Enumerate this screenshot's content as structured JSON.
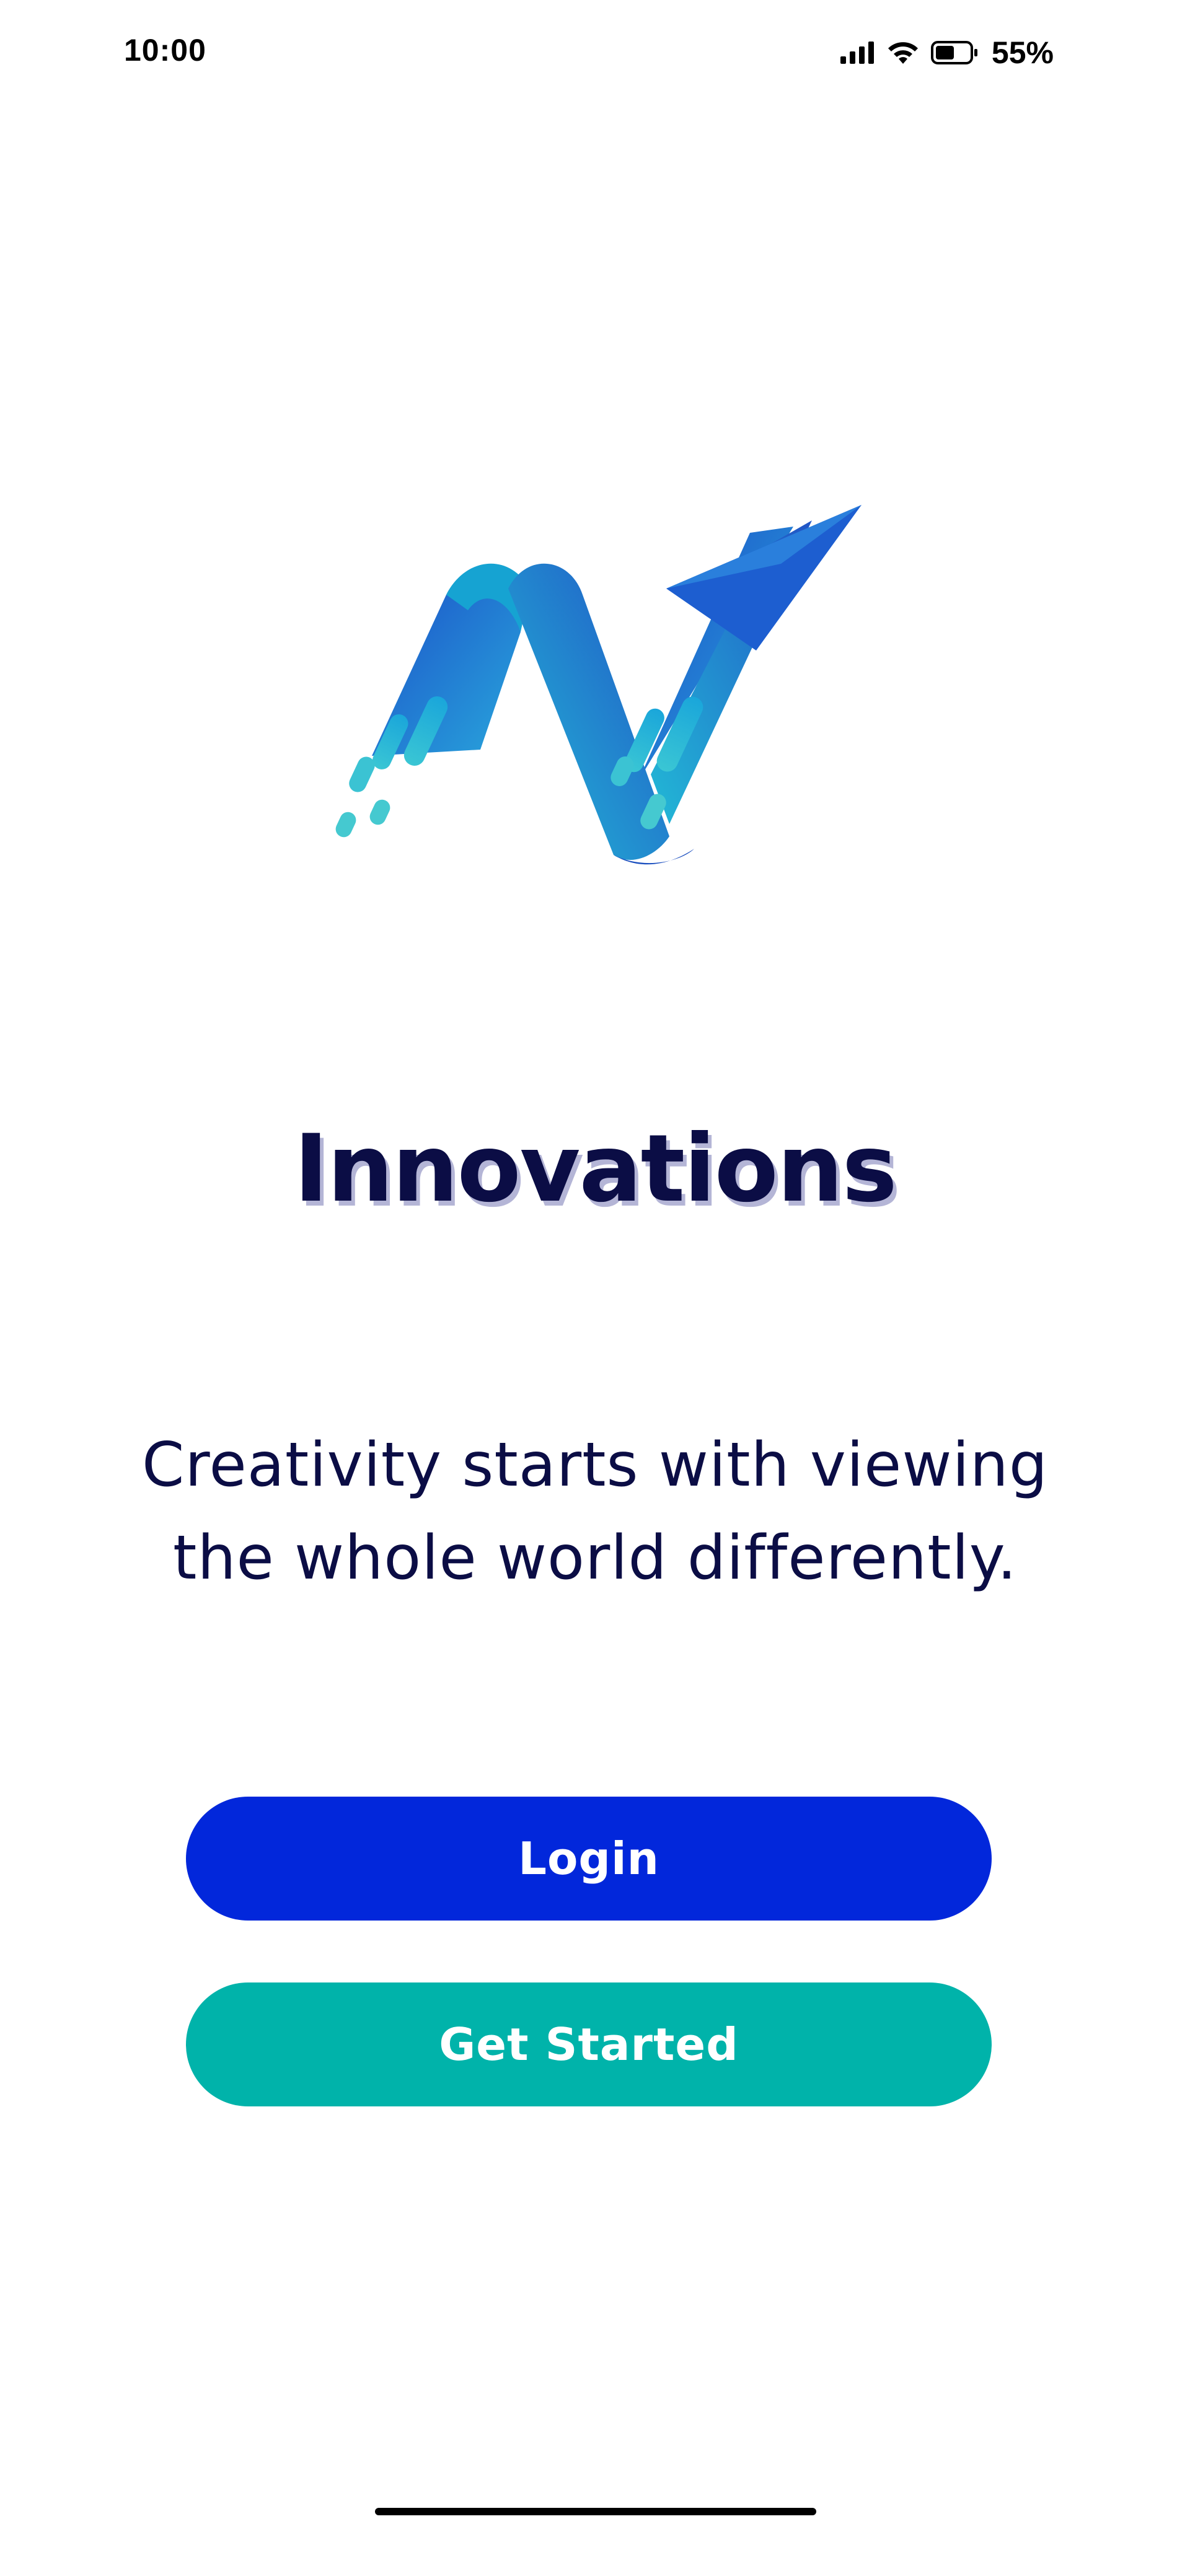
{
  "status_bar": {
    "time": "10:00",
    "battery_percent": "55%",
    "battery_level": 0.55
  },
  "brand": {
    "name": "Innovations",
    "logo_icon": "n-arrow-logo"
  },
  "tagline": {
    "line1": "Creativity starts with viewing",
    "line2": "the whole world differently."
  },
  "buttons": {
    "login_label": "Login",
    "get_started_label": "Get Started"
  },
  "colors": {
    "text": "#0b0d45",
    "login_button": "#0227db",
    "get_started_button": "#00b3aa",
    "logo_gradient_start": "#2a5bd8",
    "logo_gradient_end": "#1ab0d6"
  }
}
